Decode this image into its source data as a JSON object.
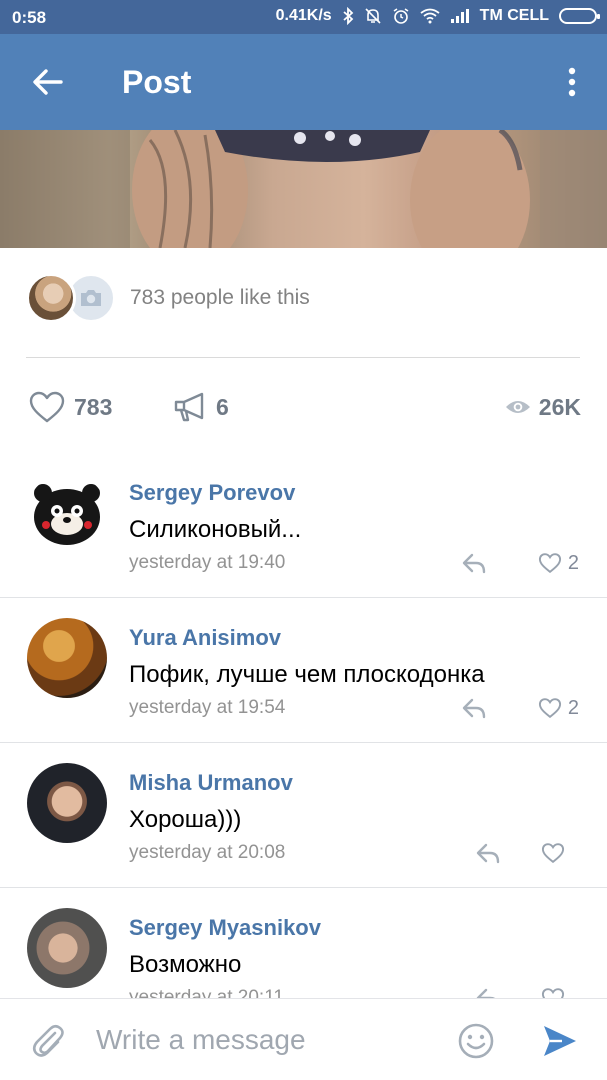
{
  "status_bar": {
    "time": "0:58",
    "network_speed": "0.41K/s",
    "carrier": "TM CELL",
    "icons": [
      "bluetooth-icon",
      "bell-off-icon",
      "alarm-icon",
      "wifi-icon",
      "signal-icon",
      "battery-icon"
    ]
  },
  "toolbar": {
    "title": "Post",
    "back_icon": "arrow-left-icon",
    "menu_icon": "more-vertical-icon"
  },
  "likes": {
    "text": "783 people like this"
  },
  "stats": {
    "likes": "783",
    "shares": "6",
    "views": "26K"
  },
  "comments": [
    {
      "author": "Sergey Porevov",
      "text": "Силиконовый...",
      "time": "yesterday at 19:40",
      "likes": "2"
    },
    {
      "author": "Yura Anisimov",
      "text": "Пофик, лучше чем плоскодонка",
      "time": "yesterday at 19:54",
      "likes": "2"
    },
    {
      "author": "Misha Urmanov",
      "text": "Хороша)))",
      "time": "yesterday at 20:08",
      "likes": ""
    },
    {
      "author": "Sergey Myasnikov",
      "text": "Возможно",
      "time": "yesterday at 20:11",
      "likes": ""
    }
  ],
  "composer": {
    "placeholder": "Write a message"
  },
  "colors": {
    "status_bar": "#44679a",
    "toolbar": "#5181b8",
    "author_name": "#4a76a8",
    "send": "#4a86c8"
  }
}
